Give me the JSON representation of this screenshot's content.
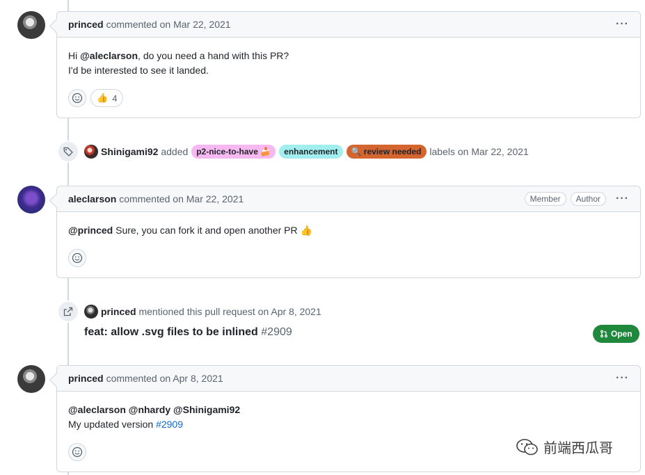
{
  "comments": [
    {
      "author": "princed",
      "meta": "commented on Mar 22, 2021",
      "body_line1_prefix": "Hi ",
      "body_line1_mention": "@aleclarson",
      "body_line1_suffix": ", do you need a hand with this PR?",
      "body_line2": "I'd be interested to see it landed.",
      "reaction_emoji": "👍",
      "reaction_count": "4"
    },
    {
      "author": "aleclarson",
      "meta": "commented on Mar 22, 2021",
      "badges": [
        "Member",
        "Author"
      ],
      "body_mention": "@princed",
      "body_text": " Sure, you can fork it and open another PR 👍"
    },
    {
      "author": "princed",
      "meta": "commented on Apr 8, 2021",
      "body_line1": "@aleclarson @nhardy @Shinigami92",
      "body_line2_text": "My updated version ",
      "body_line2_link": "#2909"
    }
  ],
  "label_event": {
    "actor": "Shinigami92",
    "verb": "added",
    "labels": [
      {
        "text": "p2-nice-to-have 🍰",
        "bg": "#f5b8f0",
        "fg": "#1f2328"
      },
      {
        "text": "enhancement",
        "bg": "#a2eeef",
        "fg": "#1f2328"
      },
      {
        "text": "🔍 review needed",
        "bg": "#d4652f",
        "fg": "#1f2328"
      }
    ],
    "suffix": "labels on Mar 22, 2021"
  },
  "mention_event": {
    "actor": "princed",
    "text": "mentioned this pull request on Apr 8, 2021",
    "pr_title": "feat: allow .svg files to be inlined",
    "pr_number": "#2909",
    "pr_state": "Open"
  },
  "kebab": "···",
  "watermark": "前端西瓜哥",
  "colors": {
    "accent_link": "#0969da",
    "open_green": "#1f883d",
    "border": "#d0d7de"
  }
}
